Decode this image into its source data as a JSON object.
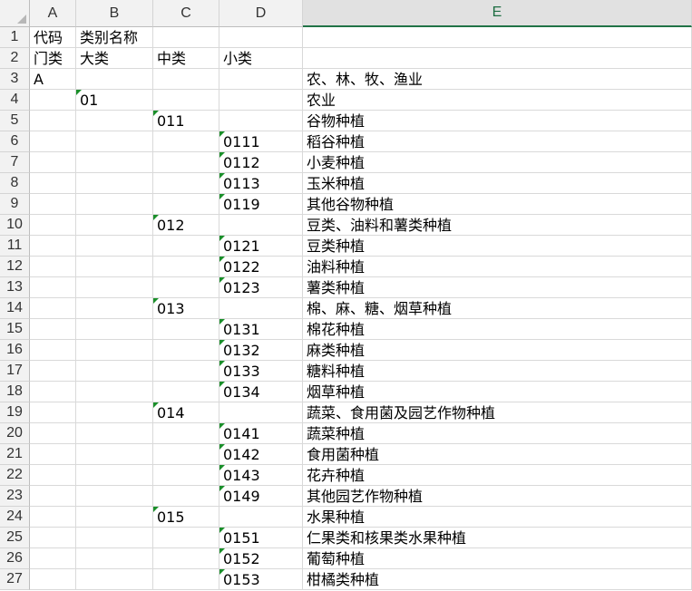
{
  "columns": [
    "A",
    "B",
    "C",
    "D",
    "E"
  ],
  "active_column": "E",
  "rows": [
    {
      "n": "1",
      "A": "代码",
      "B": "类别名称",
      "C": "",
      "D": "",
      "E": ""
    },
    {
      "n": "2",
      "A": "门类",
      "B": "大类",
      "C": "中类",
      "D": "小类",
      "E": ""
    },
    {
      "n": "3",
      "A": "A",
      "B": "",
      "C": "",
      "D": "",
      "E": "农、林、牧、渔业"
    },
    {
      "n": "4",
      "A": "",
      "B": "01",
      "C": "",
      "D": "",
      "E": "农业"
    },
    {
      "n": "5",
      "A": "",
      "B": "",
      "C": "011",
      "D": "",
      "E": "谷物种植"
    },
    {
      "n": "6",
      "A": "",
      "B": "",
      "C": "",
      "D": "0111",
      "E": "稻谷种植"
    },
    {
      "n": "7",
      "A": "",
      "B": "",
      "C": "",
      "D": "0112",
      "E": "小麦种植"
    },
    {
      "n": "8",
      "A": "",
      "B": "",
      "C": "",
      "D": "0113",
      "E": "玉米种植"
    },
    {
      "n": "9",
      "A": "",
      "B": "",
      "C": "",
      "D": "0119",
      "E": "其他谷物种植"
    },
    {
      "n": "10",
      "A": "",
      "B": "",
      "C": "012",
      "D": "",
      "E": "豆类、油料和薯类种植"
    },
    {
      "n": "11",
      "A": "",
      "B": "",
      "C": "",
      "D": "0121",
      "E": "豆类种植"
    },
    {
      "n": "12",
      "A": "",
      "B": "",
      "C": "",
      "D": "0122",
      "E": "油料种植"
    },
    {
      "n": "13",
      "A": "",
      "B": "",
      "C": "",
      "D": "0123",
      "E": "薯类种植"
    },
    {
      "n": "14",
      "A": "",
      "B": "",
      "C": "013",
      "D": "",
      "E": "棉、麻、糖、烟草种植"
    },
    {
      "n": "15",
      "A": "",
      "B": "",
      "C": "",
      "D": "0131",
      "E": "棉花种植"
    },
    {
      "n": "16",
      "A": "",
      "B": "",
      "C": "",
      "D": "0132",
      "E": "麻类种植"
    },
    {
      "n": "17",
      "A": "",
      "B": "",
      "C": "",
      "D": "0133",
      "E": "糖料种植"
    },
    {
      "n": "18",
      "A": "",
      "B": "",
      "C": "",
      "D": "0134",
      "E": "烟草种植"
    },
    {
      "n": "19",
      "A": "",
      "B": "",
      "C": "014",
      "D": "",
      "E": "蔬菜、食用菌及园艺作物种植"
    },
    {
      "n": "20",
      "A": "",
      "B": "",
      "C": "",
      "D": "0141",
      "E": "蔬菜种植"
    },
    {
      "n": "21",
      "A": "",
      "B": "",
      "C": "",
      "D": "0142",
      "E": "食用菌种植"
    },
    {
      "n": "22",
      "A": "",
      "B": "",
      "C": "",
      "D": "0143",
      "E": "花卉种植"
    },
    {
      "n": "23",
      "A": "",
      "B": "",
      "C": "",
      "D": "0149",
      "E": "其他园艺作物种植"
    },
    {
      "n": "24",
      "A": "",
      "B": "",
      "C": "015",
      "D": "",
      "E": "水果种植"
    },
    {
      "n": "25",
      "A": "",
      "B": "",
      "C": "",
      "D": "0151",
      "E": "仁果类和核果类水果种植"
    },
    {
      "n": "26",
      "A": "",
      "B": "",
      "C": "",
      "D": "0152",
      "E": "葡萄种植"
    },
    {
      "n": "27",
      "A": "",
      "B": "",
      "C": "",
      "D": "0153",
      "E": "柑橘类种植"
    }
  ],
  "colors": {
    "header_bg": "#f2f2f2",
    "grid": "#d9d9d9",
    "active_accent": "#217346",
    "number_as_text_marker": "#1a8f2a"
  }
}
